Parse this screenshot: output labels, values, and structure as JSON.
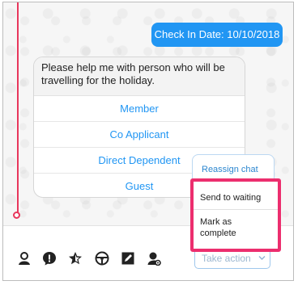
{
  "chat": {
    "outgoing_message": "Check In Date: 10/10/2018",
    "question": "Please help me with person who will be travelling for the holiday.",
    "options": [
      "Member",
      "Co Applicant",
      "Direct Dependent",
      "Guest"
    ]
  },
  "action_menu": {
    "reassign_label": "Reassign chat",
    "items": [
      "Send to waiting",
      "Mark as complete"
    ]
  },
  "toolbar": {
    "icons": [
      "person-icon",
      "alert-bubble-icon",
      "star-icon",
      "steering-wheel-icon",
      "note-icon",
      "profile-gear-icon"
    ],
    "take_action_label": "Take action"
  },
  "colors": {
    "accent": "#2196f3",
    "highlight": "#ec2e6e",
    "timeline": "#e8375c"
  }
}
